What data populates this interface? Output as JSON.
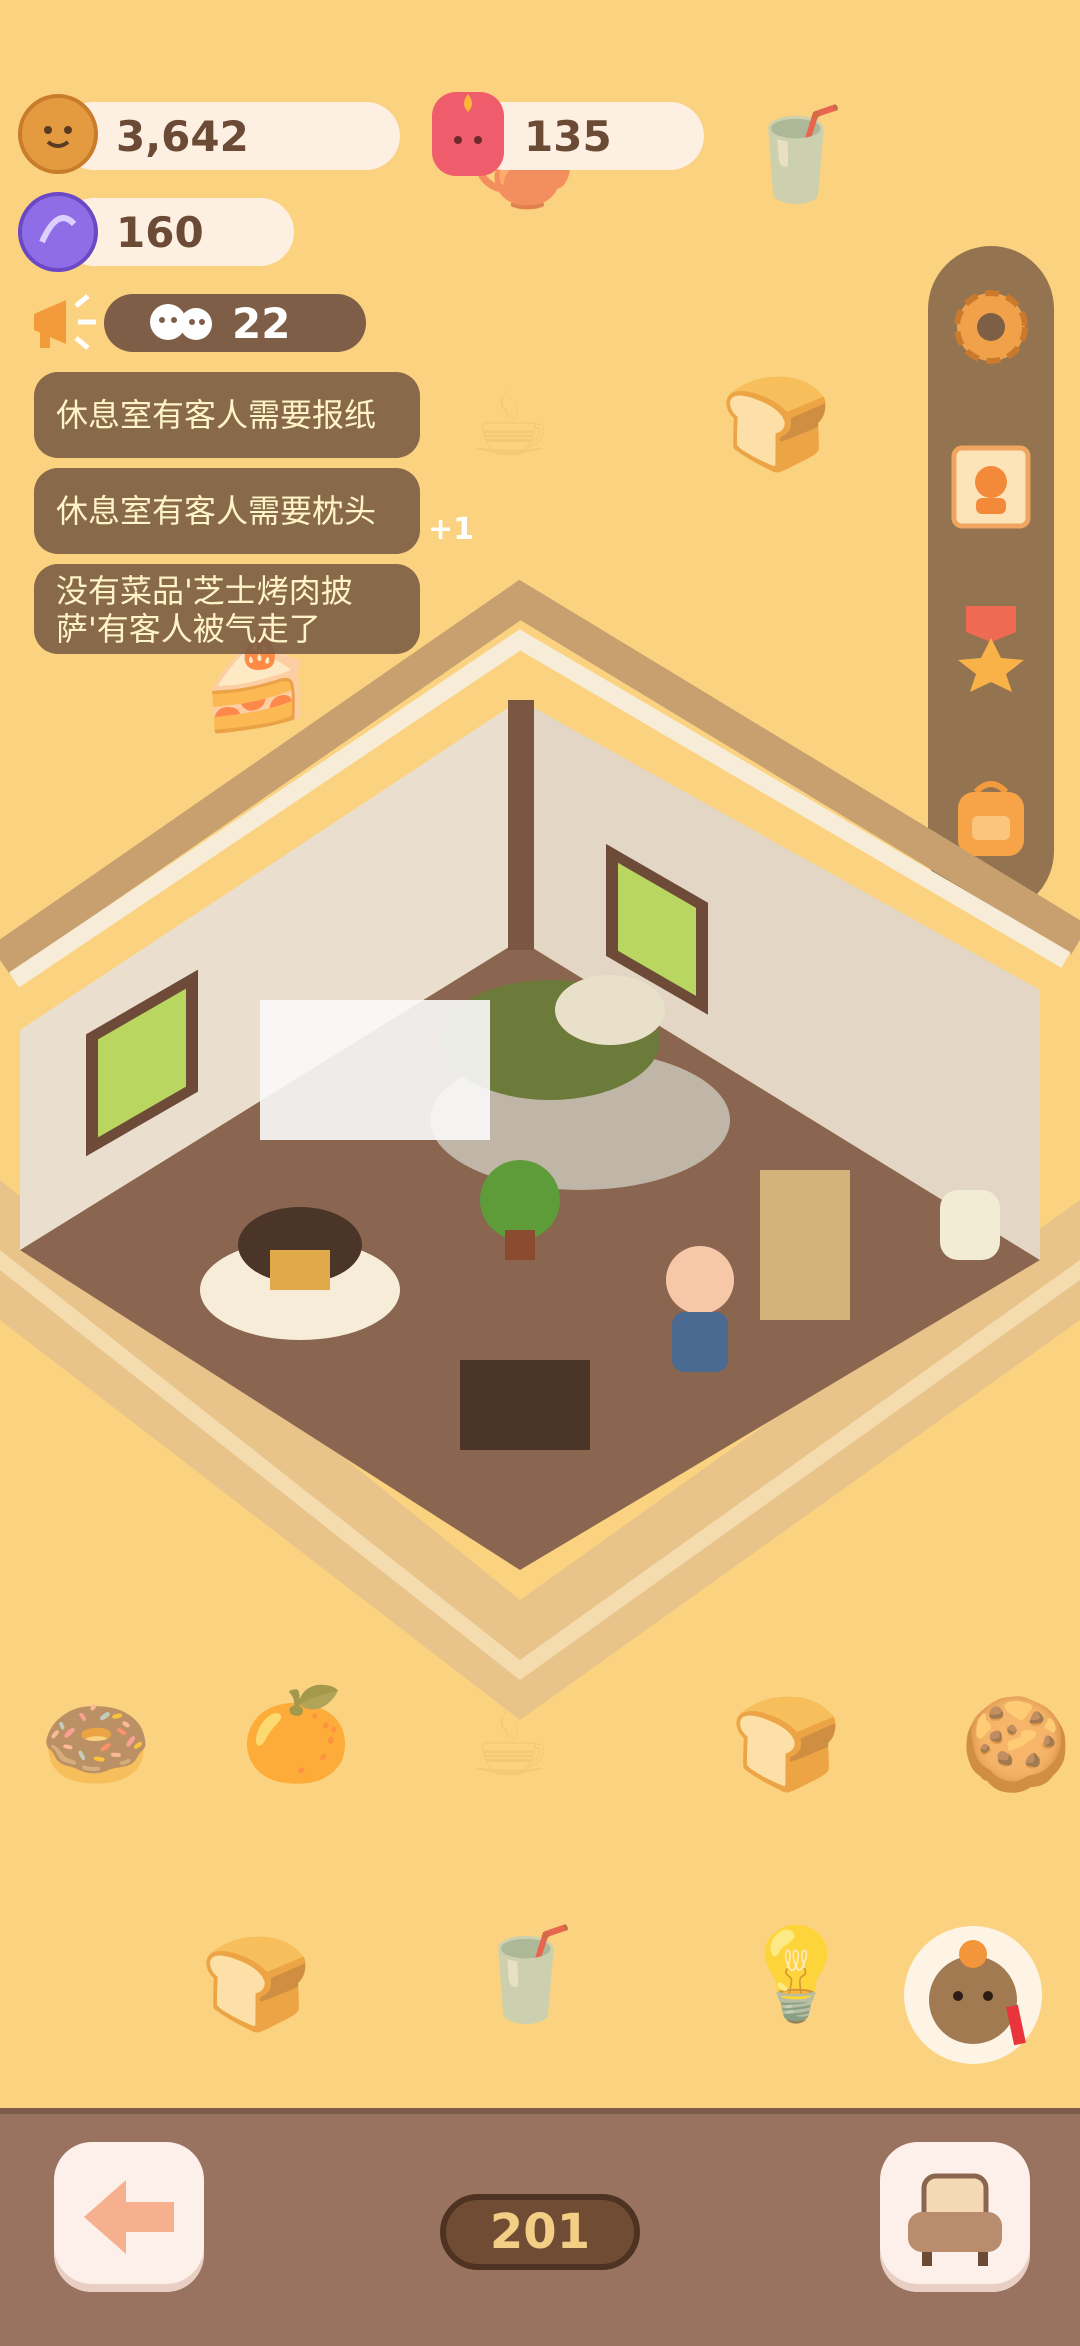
{
  "resources": {
    "cookie": {
      "value": "3,642",
      "icon": "cookie-icon"
    },
    "candle": {
      "value": "135",
      "icon": "candle-icon"
    },
    "gem": {
      "value": "160",
      "icon": "candy-gem-icon"
    },
    "guests": {
      "value": "22",
      "icon": "guests-icon",
      "announce_icon": "megaphone-icon"
    }
  },
  "notifications": [
    {
      "text": "休息室有客人需要报纸"
    },
    {
      "text": "休息室有客人需要枕头",
      "badge": "+1"
    },
    {
      "text": "没有菜品'芝士烤肉披萨'有客人被气走了"
    }
  ],
  "side_menu": [
    "settings-gear-icon",
    "customer-card-icon",
    "medal-star-icon",
    "backpack-icon"
  ],
  "bottom": {
    "room_number": "201",
    "back_icon": "back-arrow-icon",
    "furniture_icon": "armchair-icon"
  },
  "colors": {
    "background": "#fbd27f",
    "panel": "#7d5f46",
    "text_dark": "#6b4a36",
    "notification_text": "#fff3c8"
  }
}
